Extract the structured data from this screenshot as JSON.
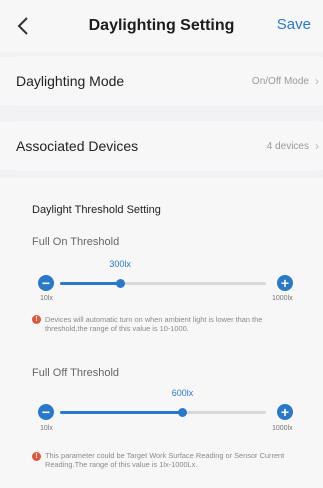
{
  "header": {
    "title": "Daylighting Setting",
    "save_label": "Save",
    "back_icon": "chevron-left-icon"
  },
  "daylighting_mode": {
    "label": "Daylighting Mode",
    "value": "On/Off Mode"
  },
  "associated_devices": {
    "label": "Associated Devices",
    "value": "4 devices"
  },
  "threshold": {
    "section_title": "Daylight Threshold Setting",
    "full_on": {
      "label": "Full On Threshold",
      "value_label": "300lx",
      "value": 300,
      "min_label": "10lx",
      "max_label": "1000lx",
      "min": 10,
      "max": 1000,
      "info": "Devices will automatic turn on when ambient light is lower than the threshold,the range of this value is 10-1000."
    },
    "full_off": {
      "label": "Full Off Threshold",
      "value_label": "600lx",
      "value": 600,
      "min_label": "10lx",
      "max_label": "1000lx",
      "min": 10,
      "max": 1000,
      "info": "This parameter could be Target Work Surface Reading or Sensor Current Reading.The range of this value is 1lx-1000Lx."
    }
  },
  "colors": {
    "accent": "#2a79c9",
    "warning": "#e2563a"
  }
}
